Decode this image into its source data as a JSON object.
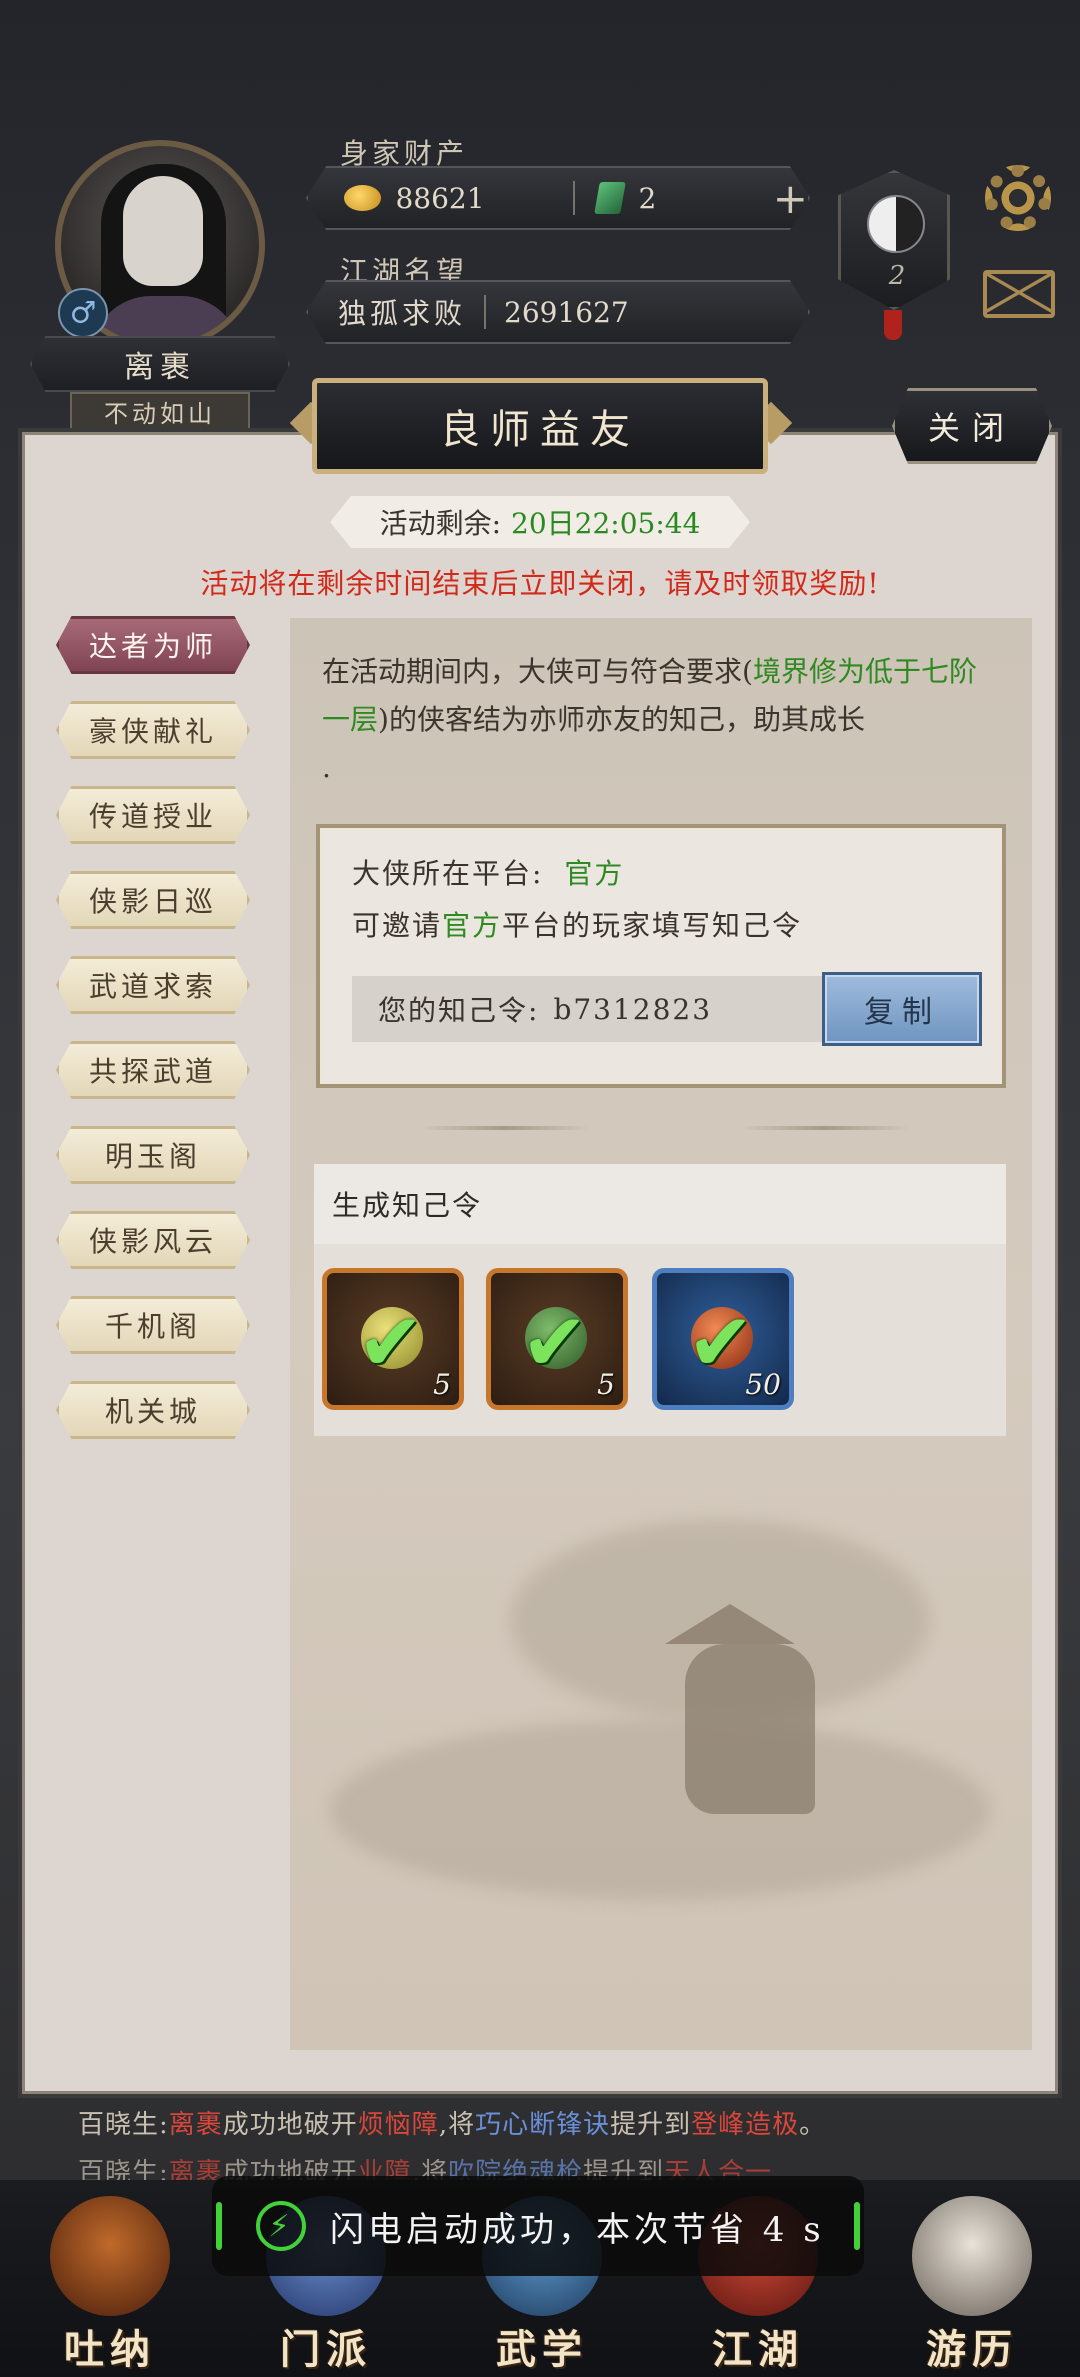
{
  "hud": {
    "assets_label": "身家财产",
    "gold": "88621",
    "jade": "2",
    "plus": "+",
    "reputation_label": "江湖名望",
    "rank_title": "独孤求败",
    "reputation_value": "2691627",
    "player_name": "离裹",
    "player_subtitle": "不动如山",
    "taiji_level": "2",
    "gender_symbol": "♂"
  },
  "panel": {
    "title": "良师益友",
    "close_label": "关闭",
    "timer_label": "活动剩余:",
    "timer_value": "20日22:05:44",
    "warning": "活动将在剩余时间结束后立即关闭，请及时领取奖励!"
  },
  "sidebar": {
    "items": [
      {
        "label": "达者为师",
        "active": true
      },
      {
        "label": "豪侠献礼",
        "active": false
      },
      {
        "label": "传道授业",
        "active": false
      },
      {
        "label": "侠影日巡",
        "active": false
      },
      {
        "label": "武道求索",
        "active": false
      },
      {
        "label": "共探武道",
        "active": false
      },
      {
        "label": "明玉阁",
        "active": false
      },
      {
        "label": "侠影风云",
        "active": false
      },
      {
        "label": "千机阁",
        "active": false
      },
      {
        "label": "机关城",
        "active": false
      }
    ]
  },
  "content": {
    "desc_1": "在活动期间内，大侠可与符合要求(",
    "desc_green": "境界修为低于七阶一层",
    "desc_2": ")的侠客结为亦师亦友的知己，助其成长",
    "desc_dot": ".",
    "platform_label": "大侠所在平台:",
    "platform_value": "官方",
    "invite_1": "可邀请",
    "invite_green": "官方",
    "invite_2": "平台的玩家填写知己令",
    "code_label": "您的知己令:",
    "code_value": "b7312823",
    "copy_label": "复制",
    "gen_header": "生成知己令",
    "rewards": [
      {
        "qty": "5",
        "frame": "orange",
        "orb_color": "#c8c24a"
      },
      {
        "qty": "5",
        "frame": "orange",
        "orb_color": "#3f7c3c"
      },
      {
        "qty": "50",
        "frame": "blue",
        "orb_color": "#d2552b"
      }
    ]
  },
  "feed": {
    "line1": {
      "prefix": "百晓生:",
      "name": "离裹",
      "mid": "成功地破开",
      "obs": "烦恼障",
      "mid2": ",将",
      "skill": "巧心断锋诀",
      "mid3": "提升到",
      "level": "登峰造极",
      "end": "。"
    },
    "line2": {
      "prefix": "百晓生:",
      "name": "离裹",
      "mid": "成功地破开",
      "obs": "业障",
      "mid2": ",将",
      "skill": "吹院绝魂枪",
      "mid3": "提升到",
      "level": "天人合一"
    }
  },
  "toast": {
    "icon": "lightning-icon",
    "text": "闪电启动成功，本次节省 4 s"
  },
  "nav": [
    {
      "label": "吐纳",
      "color": "#8a3a18"
    },
    {
      "label": "门派",
      "color": "#3d5fa8"
    },
    {
      "label": "武学",
      "color": "#3b6fa0"
    },
    {
      "label": "江湖",
      "color": "#a03226"
    },
    {
      "label": "游历",
      "color": "#b9b2a6"
    }
  ],
  "colors": {
    "accent_green": "#2f8a22",
    "warning_red": "#d22a1a",
    "active_tab": "#7f4453"
  }
}
